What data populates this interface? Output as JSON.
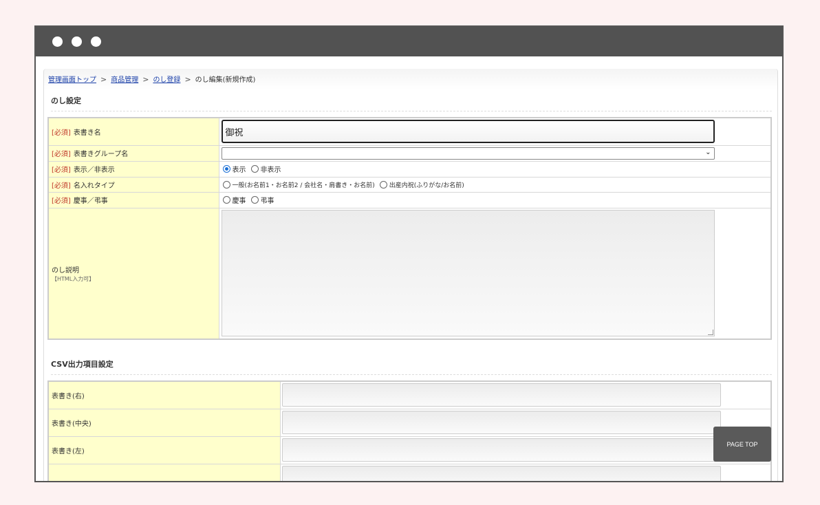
{
  "breadcrumb": {
    "items": [
      "管理画面トップ",
      "商品管理",
      "のし登録"
    ],
    "current": "のし編集(新規作成)",
    "separator": ">"
  },
  "section1": {
    "title": "のし設定",
    "required_tag": "[必須]",
    "rows": {
      "omotegaki": {
        "label": "表書き名",
        "value": "御祝"
      },
      "group": {
        "label": "表書きグループ名",
        "value": ""
      },
      "display": {
        "label": "表示／非表示",
        "opt1": "表示",
        "opt2": "非表示",
        "selected": "表示"
      },
      "naire": {
        "label": "名入れタイプ",
        "opt1": "一般(お名前1・お名前2 / 会社名・肩書き・お名前)",
        "opt2": "出産内祝(ふりがな/お名前)"
      },
      "keiji": {
        "label": "慶事／弔事",
        "opt1": "慶事",
        "opt2": "弔事"
      },
      "desc": {
        "label": "のし説明",
        "note": "【HTML入力可】",
        "value": ""
      }
    }
  },
  "section2": {
    "title": "CSV出力項目設定",
    "rows": [
      "表書き(右)",
      "表書き(中央)",
      "表書き(左)"
    ]
  },
  "page_top": "PAGE TOP",
  "colors": {
    "label_bg": "#ffffcc",
    "required": "#c0392b",
    "titlebar": "#525252"
  }
}
